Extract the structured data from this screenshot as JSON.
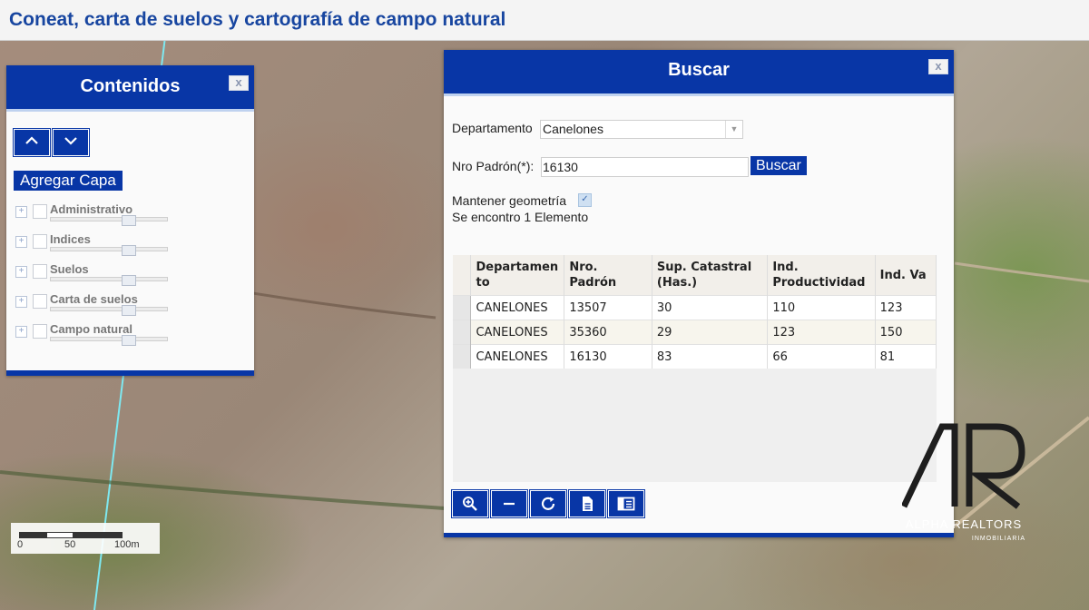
{
  "app": {
    "title": "Coneat, carta de suelos y cartografía de campo natural"
  },
  "contenidos": {
    "title": "Contenidos",
    "close_label": "x",
    "agregar_label": "Agregar Capa",
    "layers": [
      {
        "name": "Administrativo"
      },
      {
        "name": "Indices"
      },
      {
        "name": "Suelos"
      },
      {
        "name": "Carta de suelos"
      },
      {
        "name": "Campo natural"
      }
    ]
  },
  "scalebar": {
    "labels": [
      "0",
      "50",
      "100m"
    ]
  },
  "buscar": {
    "title": "Buscar",
    "close_label": "x",
    "departamento_label": "Departamento",
    "departamento_value": "Canelones",
    "padron_label": "Nro Padrón(*):",
    "padron_value": "16130",
    "buscar_button": "Buscar",
    "mantener_label": "Mantener geometría",
    "result_text": "Se encontro 1 Elemento",
    "columns": [
      "Departamen to",
      "Nro. Padrón",
      "Sup. Catastral (Has.)",
      "Ind. Productividad",
      "Ind. Va"
    ],
    "rows": [
      [
        "CANELONES",
        "13507",
        "30",
        "110",
        "123"
      ],
      [
        "CANELONES",
        "35360",
        "29",
        "123",
        "150"
      ],
      [
        "CANELONES",
        "16130",
        "83",
        "66",
        "81"
      ]
    ]
  },
  "watermark": {
    "brand": "ALPHA REALTORS",
    "sub": "INMOBILIARIA"
  },
  "colors": {
    "accent": "#0836a6",
    "title_text": "#1846a0"
  }
}
